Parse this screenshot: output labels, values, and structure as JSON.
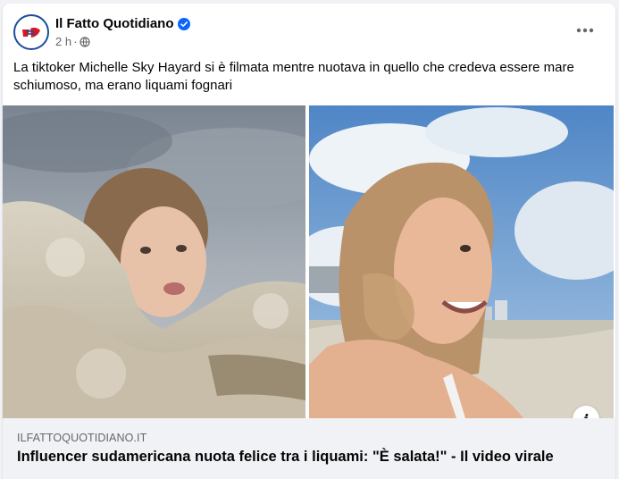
{
  "post": {
    "page_name": "Il Fatto Quotidiano",
    "timestamp": "2 h",
    "separator": "·",
    "caption": "La tiktoker Michelle Sky Hayard si è filmata mentre nuotava in quello che credeva essere mare schiumoso, ma erano liquami fognari",
    "images": [
      {
        "name": "woman in foamy water"
      },
      {
        "name": "woman smiling with foam on face"
      }
    ]
  },
  "link": {
    "domain": "ILFATTOQUOTIDIANO.IT",
    "title": "Influencer sudamericana nuota felice tra i liquami: \"È salata!\" - Il video virale",
    "info_icon": "i"
  },
  "icons": {
    "verified": "verified-badge-icon",
    "privacy": "globe-icon",
    "more": "more-options-icon",
    "info": "info-icon"
  },
  "colors": {
    "verified": "#0866ff",
    "secondary_text": "#65676b",
    "link_bg": "#f0f2f5"
  }
}
